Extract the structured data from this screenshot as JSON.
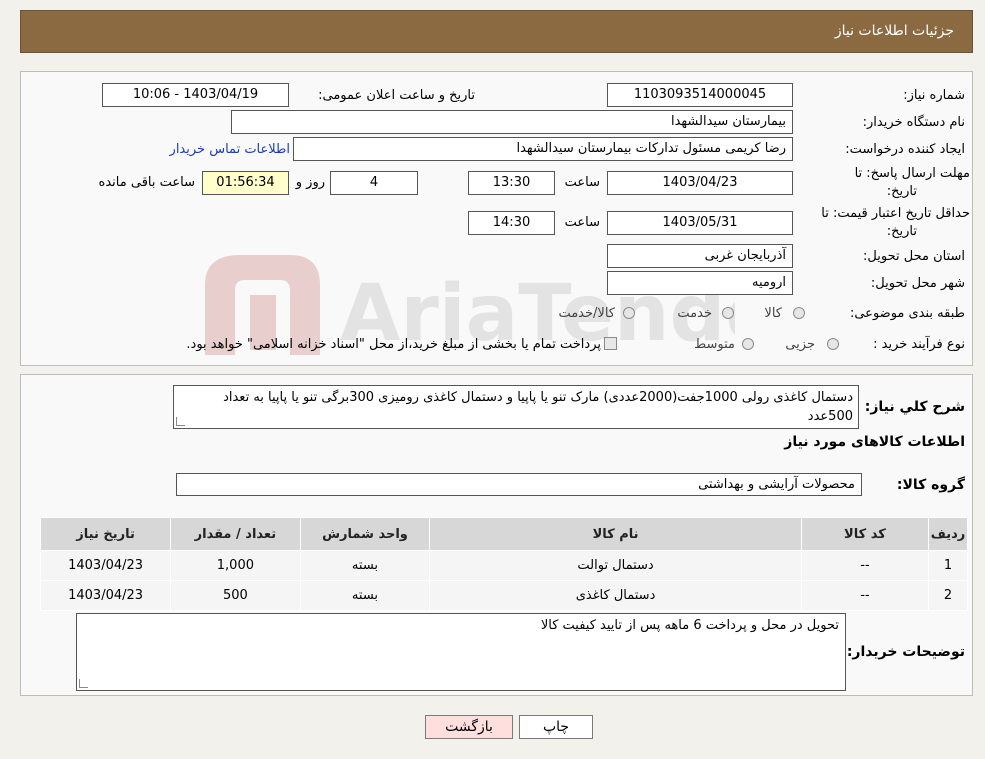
{
  "header": {
    "title": "جزئیات اطلاعات نیاز"
  },
  "form": {
    "need_number_label": "شماره نیاز:",
    "need_number": "1103093514000045",
    "announce_label": "تاریخ و ساعت اعلان عمومی:",
    "announce_value": "1403/04/19 - 10:06",
    "buyer_label": "نام دستگاه خریدار:",
    "buyer_value": "بیمارستان سیدالشهدا",
    "creator_label": "ایجاد کننده درخواست:",
    "creator_value": "رضا کریمی مسئول تدارکات بیمارستان سیدالشهدا",
    "contact_link": "اطلاعات تماس خریدار",
    "deadline_label_1": "مهلت ارسال پاسخ: تا",
    "deadline_label_2": "تاریخ:",
    "deadline_date": "1403/04/23",
    "time_label": "ساعت",
    "deadline_time": "13:30",
    "days_value": "4",
    "days_label": "روز و",
    "remaining_value": "01:56:34",
    "remaining_label": "ساعت باقی مانده",
    "validity_label_1": "حداقل تاریخ اعتبار قیمت: تا",
    "validity_label_2": "تاریخ:",
    "validity_date": "1403/05/31",
    "validity_time": "14:30",
    "province_label": "استان محل تحویل:",
    "province_value": "آذربایجان غربی",
    "city_label": "شهر محل تحویل:",
    "city_value": "ارومیه",
    "category_label": "طبقه بندی موضوعی:",
    "category_options": [
      "کالا",
      "خدمت",
      "کالا/خدمت"
    ],
    "process_label": "نوع فرآیند خرید :",
    "process_options": [
      "جزیی",
      "متوسط"
    ],
    "process_note": "پرداخت تمام یا بخشی از مبلغ خرید،از محل \"اسناد خزانه اسلامی\" خواهد بود."
  },
  "details": {
    "general_label": "شرح کلي نياز:",
    "general_text": "دستمال کاغذی رولی 1000جفت(2000عددی) مارک تنو یا پاپیا و دستمال کاغذی رومیزی 300برگی تنو یا پاپیا به تعداد 500عدد",
    "goods_info_label": "اطلاعات کالاهای مورد نیاز",
    "group_label": "گروه کالا:",
    "group_value": "محصولات آرایشی و بهداشتی",
    "table": {
      "headers": [
        "ردیف",
        "کد کالا",
        "نام کالا",
        "واحد شمارش",
        "تعداد / مقدار",
        "تاریخ نیاز"
      ],
      "rows": [
        [
          "1",
          "--",
          "دستمال توالت",
          "بسته",
          "1,000",
          "1403/04/23"
        ],
        [
          "2",
          "--",
          "دستمال کاغذی",
          "بسته",
          "500",
          "1403/04/23"
        ]
      ]
    },
    "buyer_notes_label": "توضیحات خریدار:",
    "buyer_notes": "تحویل در محل و پرداخت 6 ماهه پس از تایید کیفیت کالا"
  },
  "watermark": {
    "text": "AriaTender.neT"
  },
  "buttons": {
    "print": "چاپ",
    "back": "بازگشت"
  },
  "colors": {
    "header_bg": "#8b6a41",
    "link": "#1a3db5",
    "back_button": "#ffdede",
    "watermark": "#b33a3a"
  }
}
